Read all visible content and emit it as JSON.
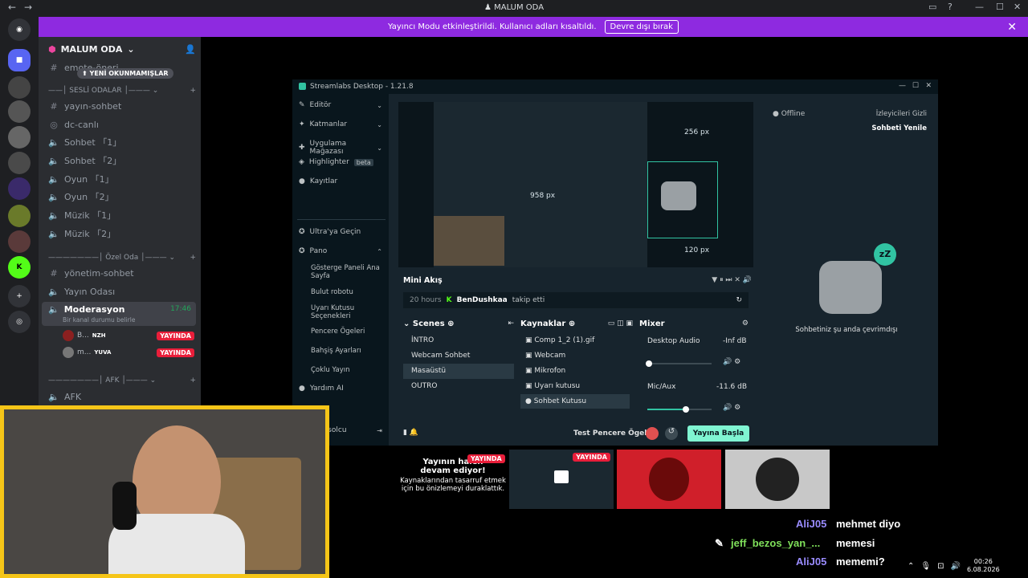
{
  "window": {
    "title": "MALUM ODA"
  },
  "banner": {
    "text": "Yayıncı Modu etkinleştirildi. Kullanıcı adları kısaltıldı.",
    "button": "Devre dışı bırak"
  },
  "server": {
    "name": "MALUM ODA",
    "unread_pill": "YENİ OKUNMAMIŞLAR",
    "top_channel": "emote-öneri",
    "categories": {
      "voice": "SESLİ ODALAR",
      "private": "Özel Oda",
      "afk": "AFK"
    },
    "channels": [
      {
        "label": "yayın-sohbet"
      },
      {
        "label": "dc-canlı"
      },
      {
        "label": "Sohbet 「1」"
      },
      {
        "label": "Sohbet 「2」"
      },
      {
        "label": "Oyun 「1」"
      },
      {
        "label": "Oyun 「2」"
      },
      {
        "label": "Müzik 「1」"
      },
      {
        "label": "Müzik 「2」"
      },
      {
        "label": "yönetim-sohbet"
      },
      {
        "label": "Yayın Odası"
      },
      {
        "label": "AFK"
      }
    ],
    "active_voice": {
      "name": "Moderasyon",
      "time": "17:46",
      "status": "Bir kanal durumu belirle",
      "members": [
        {
          "name": "B...",
          "tag": "NZH",
          "badge": "YAYINDA"
        },
        {
          "name": "m...",
          "tag": "YUVA",
          "badge": "YAYINDA"
        }
      ]
    }
  },
  "streamlabs": {
    "title": "Streamlabs Desktop - 1.21.8",
    "nav": [
      {
        "label": "Editör"
      },
      {
        "label": "Katmanlar"
      },
      {
        "label": "Uygulama Mağazası"
      },
      {
        "label": "Highlighter",
        "badge": "beta"
      },
      {
        "label": "Kayıtlar"
      }
    ],
    "nav_lower": [
      {
        "label": "Ultra'ya Geçin"
      },
      {
        "label": "Pano"
      }
    ],
    "pano_sub": [
      "Gösterge Paneli Ana Sayfa",
      "Bulut robotu",
      "Uyarı Kutusu Seçenekleri",
      "Pencere Ögeleri",
      "Bahşiş Ayarları",
      "Çoklu Yayın"
    ],
    "yardim": "Yardım AI",
    "user_short": "lifsolcu",
    "preview_labels": {
      "top": "256 px",
      "left": "958 px",
      "bottom": "120 px"
    },
    "mini_feed": {
      "title": "Mini Akış",
      "time": "20 hours",
      "user": "BenDushkaa",
      "action": "takip etti"
    },
    "scenes": {
      "title": "Scenes",
      "items": [
        "İNTRO",
        "Webcam Sohbet",
        "Masaüstü",
        "OUTRO"
      ],
      "selected": "Masaüstü"
    },
    "sources": {
      "title": "Kaynaklar",
      "items": [
        "Comp 1_2 (1).gif",
        "Webcam",
        "Mikrofon",
        "Uyarı kutusu",
        "Sohbet Kutusu"
      ]
    },
    "mixer": {
      "title": "Mixer",
      "channels": [
        {
          "name": "Desktop Audio",
          "level": "-Inf dB",
          "fill": 0.02
        },
        {
          "name": "Mic/Aux",
          "level": "-11.6 dB",
          "fill": 0.6
        }
      ]
    },
    "footer": {
      "test": "Test Pencere Ögeleri",
      "go_live": "Yayına Başla"
    },
    "chat_panel": {
      "status": "Offline",
      "hide_viewers": "İzleyicileri Gizli",
      "refresh": "Sohbeti Yenile",
      "offline_msg": "Sohbetiniz şu anda çevrimdışı"
    }
  },
  "stream_grid": {
    "paused_title": "Yayının halen devam ediyor!",
    "paused_sub": "Kaynaklarından tasarruf etmek için bu önizlemeyi duraklattık.",
    "live_badge": "YAYINDA"
  },
  "chat": [
    {
      "user": "AliJ05",
      "msg": "mehmet diyo",
      "color": "#9a8cff"
    },
    {
      "user": "jeff_bezos_yan_...",
      "msg": "memesi",
      "color": "#7fe05a"
    },
    {
      "user": "AliJ05",
      "msg": "mememi?",
      "color": "#9a8cff"
    }
  ],
  "tray": {
    "time": "00:26",
    "date": "6.08.2026"
  },
  "colors": {
    "brand": "#5865f2",
    "banner": "#8e2ae0",
    "live": "#e91e3a",
    "streamlabs_accent": "#31c3a2",
    "cam_border": "#f5c518"
  }
}
